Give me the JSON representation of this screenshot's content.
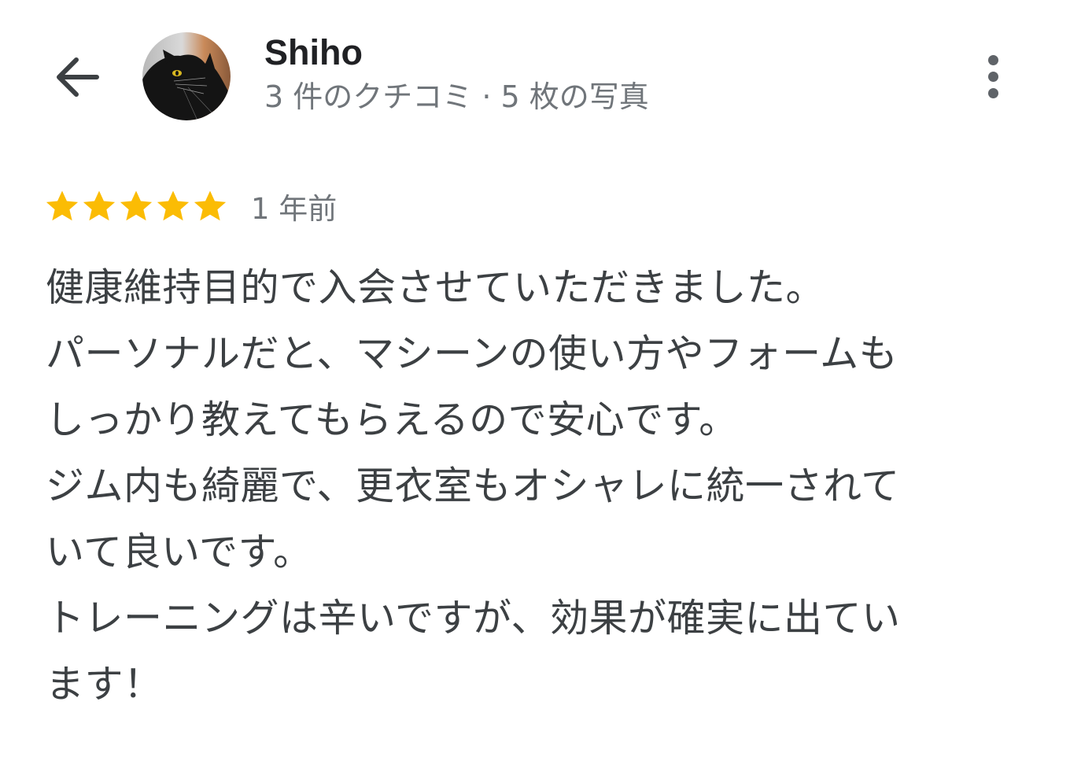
{
  "header": {
    "back_icon": "arrow-back-icon",
    "avatar_icon": "black-cat-avatar",
    "user_name": "Shiho",
    "user_stats": "3 件のクチコミ · 5 枚の写真",
    "more_icon": "more-vertical-icon"
  },
  "review": {
    "rating": 5,
    "max_rating": 5,
    "star_color": "#fbbc04",
    "date": "1 年前",
    "lines": [
      "健康維持目的で入会させていただきました。",
      "パーソナルだと、マシーンの使い方やフォームも",
      "しっかり教えてもらえるので安心です。",
      "ジム内も綺麗で、更衣室もオシャレに統一されて",
      "いて良いです。",
      "トレーニングは辛いですが、効果が確実に出てい",
      "ます！"
    ]
  }
}
